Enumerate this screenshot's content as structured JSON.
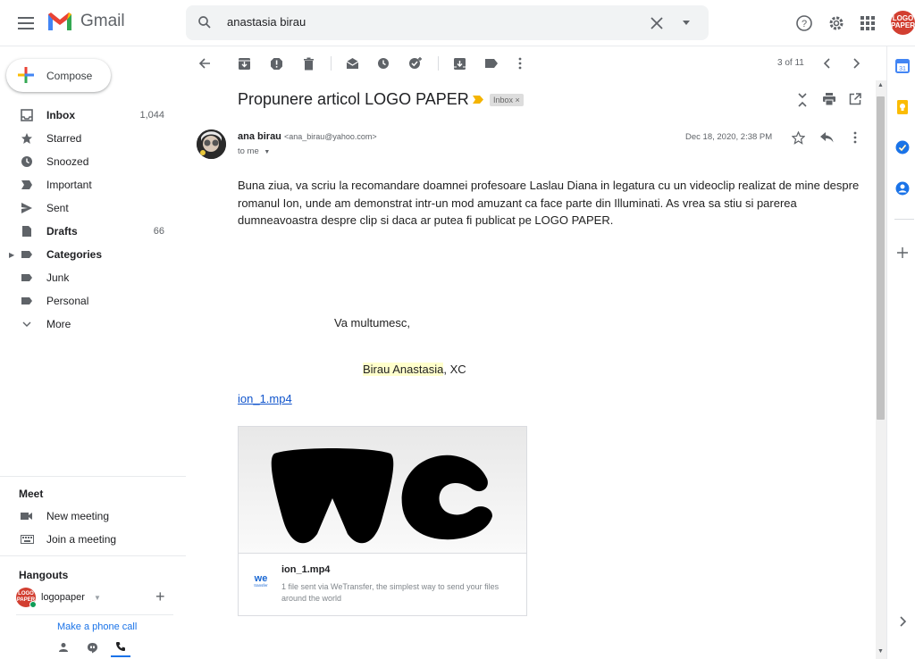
{
  "header": {
    "app_name": "Gmail",
    "search_value": "anastasia birau",
    "avatar_text": "LOGO PAPER"
  },
  "sidebar": {
    "compose_label": "Compose",
    "items": [
      {
        "label": "Inbox",
        "count": "1,044",
        "icon": "inbox-icon",
        "bold": true
      },
      {
        "label": "Starred",
        "count": "",
        "icon": "star-icon"
      },
      {
        "label": "Snoozed",
        "count": "",
        "icon": "clock-icon"
      },
      {
        "label": "Important",
        "count": "",
        "icon": "important-icon"
      },
      {
        "label": "Sent",
        "count": "",
        "icon": "send-icon"
      },
      {
        "label": "Drafts",
        "count": "66",
        "icon": "draft-icon",
        "bold": true
      },
      {
        "label": "Categories",
        "count": "",
        "icon": "label-icon",
        "bold": true
      },
      {
        "label": "Junk",
        "count": "",
        "icon": "label-icon"
      },
      {
        "label": "Personal",
        "count": "",
        "icon": "label-icon"
      },
      {
        "label": "More",
        "count": "",
        "icon": "chevron-down-icon"
      }
    ],
    "meet": {
      "title": "Meet",
      "new_meeting": "New meeting",
      "join_meeting": "Join a meeting"
    },
    "hangouts": {
      "title": "Hangouts",
      "user": "logopaper",
      "avatar_text": "LOGO PAPER",
      "phone_link": "Make a phone call"
    }
  },
  "toolbar": {
    "pager": "3 of 11"
  },
  "message": {
    "subject": "Propunere articol LOGO PAPER",
    "label_chip": "Inbox",
    "label_chip_close": "×",
    "sender_name": "ana birau",
    "sender_email": "<ana_birau@yahoo.com>",
    "to": "to me",
    "date": "Dec 18, 2020, 2:38 PM",
    "body": "Buna ziua, va scriu la recomandare doamnei profesoare Laslau Diana in legatura cu un videoclip realizat de mine despre romanul Ion, unde am demonstrat intr-un mod amuzant ca face parte din Illuminati. As vrea sa stiu si parerea dumneavoastra despre clip si daca ar putea fi publicat pe LOGO PAPER.",
    "thanks": "Va multumesc,",
    "signature_name": "Birau Anastasia",
    "signature_suffix": ",  XC",
    "attachment_link": "ion_1.mp4",
    "card": {
      "title": "ion_1.mp4",
      "description": "1 file sent via WeTransfer, the simplest way to send your files around the world",
      "logo_text": "we",
      "logo_sub": "transfer"
    }
  },
  "colors": {
    "accent": "#1a73e8",
    "important": "#f4b400",
    "avatar_red": "#d23f31"
  }
}
